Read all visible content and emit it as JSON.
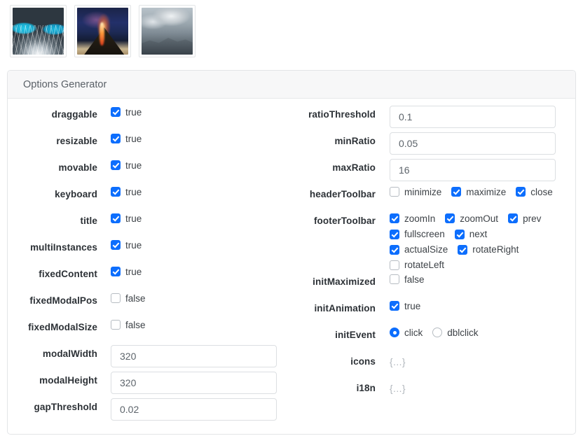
{
  "thumbnails": [
    {
      "name": "aerial-volcano-turquoise-lagoon",
      "alt": "Aerial view of volcano with turquoise water"
    },
    {
      "name": "erupting-volcano-night",
      "alt": "Erupting volcano with lava at night"
    },
    {
      "name": "ash-cloud-rocky-ridge",
      "alt": "Gray ash cloud over rocky volcanic ridge"
    }
  ],
  "panel": {
    "title": "Options Generator"
  },
  "colors": {
    "accent": "#0d6efd",
    "panel_header_bg": "#f7f7f8",
    "border": "#e3e5e7",
    "label": "#2c3136",
    "muted": "#b0b6bc"
  },
  "left_column": {
    "rows": [
      {
        "label": "draggable",
        "type": "checkbox",
        "checked": true,
        "value": "true"
      },
      {
        "label": "resizable",
        "type": "checkbox",
        "checked": true,
        "value": "true"
      },
      {
        "label": "movable",
        "type": "checkbox",
        "checked": true,
        "value": "true"
      },
      {
        "label": "keyboard",
        "type": "checkbox",
        "checked": true,
        "value": "true"
      },
      {
        "label": "title",
        "type": "checkbox",
        "checked": true,
        "value": "true"
      },
      {
        "label": "multiInstances",
        "type": "checkbox",
        "checked": true,
        "value": "true"
      },
      {
        "label": "fixedContent",
        "type": "checkbox",
        "checked": true,
        "value": "true"
      },
      {
        "label": "fixedModalPos",
        "type": "checkbox",
        "checked": false,
        "value": "false"
      },
      {
        "label": "fixedModalSize",
        "type": "checkbox",
        "checked": false,
        "value": "false"
      },
      {
        "label": "modalWidth",
        "type": "text",
        "value": "320"
      },
      {
        "label": "modalHeight",
        "type": "text",
        "value": "320"
      },
      {
        "label": "gapThreshold",
        "type": "text",
        "value": "0.02"
      }
    ]
  },
  "right_column": {
    "rows": [
      {
        "label": "ratioThreshold",
        "type": "text",
        "value": "0.1"
      },
      {
        "label": "minRatio",
        "type": "text",
        "value": "0.05"
      },
      {
        "label": "maxRatio",
        "type": "text",
        "value": "16"
      },
      {
        "label": "headerToolbar",
        "type": "checkbox-group",
        "lines": [
          [
            {
              "label": "minimize",
              "checked": false
            },
            {
              "label": "maximize",
              "checked": true
            },
            {
              "label": "close",
              "checked": true
            }
          ]
        ]
      },
      {
        "label": "footerToolbar",
        "type": "checkbox-group",
        "lines": [
          [
            {
              "label": "zoomIn",
              "checked": true
            },
            {
              "label": "zoomOut",
              "checked": true
            },
            {
              "label": "prev",
              "checked": true
            }
          ],
          [
            {
              "label": "fullscreen",
              "checked": true
            },
            {
              "label": "next",
              "checked": true
            }
          ],
          [
            {
              "label": "actualSize",
              "checked": true
            },
            {
              "label": "rotateRight",
              "checked": true
            }
          ],
          [
            {
              "label": "rotateLeft",
              "checked": false
            }
          ]
        ]
      },
      {
        "label": "initMaximized",
        "type": "checkbox",
        "checked": false,
        "value": "false"
      },
      {
        "label": "initAnimation",
        "type": "checkbox",
        "checked": true,
        "value": "true"
      },
      {
        "label": "initEvent",
        "type": "radio-group",
        "options": [
          {
            "label": "click",
            "selected": true
          },
          {
            "label": "dblclick",
            "selected": false
          }
        ]
      },
      {
        "label": "icons",
        "type": "object",
        "value": "{…}"
      },
      {
        "label": "i18n",
        "type": "object",
        "value": "{…}"
      }
    ]
  }
}
